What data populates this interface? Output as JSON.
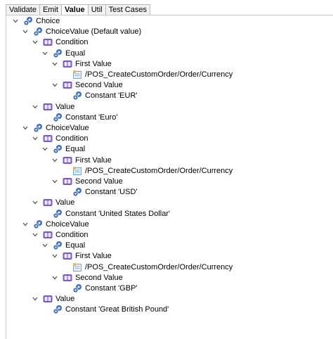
{
  "tabs": [
    {
      "label": "Validate",
      "active": false
    },
    {
      "label": "Emit",
      "active": false
    },
    {
      "label": "Value",
      "active": true
    },
    {
      "label": "Util",
      "active": false
    },
    {
      "label": "Test Cases",
      "active": false
    }
  ],
  "tree": [
    {
      "label": "Choice",
      "depth": 0,
      "icon": "gears-icon",
      "expanded": true
    },
    {
      "label": "ChoiceValue (Default value)",
      "depth": 1,
      "icon": "gears-icon",
      "expanded": true
    },
    {
      "label": "Condition",
      "depth": 2,
      "icon": "condition-icon",
      "expanded": true
    },
    {
      "label": "Equal",
      "depth": 3,
      "icon": "gears-icon",
      "expanded": true
    },
    {
      "label": "First Value",
      "depth": 4,
      "icon": "condition-icon",
      "expanded": true
    },
    {
      "label": "/POS_CreateCustomOrder/Order/Currency",
      "depth": 5,
      "icon": "path-node-icon",
      "expanded": null
    },
    {
      "label": "Second Value",
      "depth": 4,
      "icon": "condition-icon",
      "expanded": true
    },
    {
      "label": "Constant 'EUR'",
      "depth": 5,
      "icon": "gears-icon",
      "expanded": null
    },
    {
      "label": "Value",
      "depth": 2,
      "icon": "condition-icon",
      "expanded": true
    },
    {
      "label": "Constant 'Euro'",
      "depth": 3,
      "icon": "gears-icon",
      "expanded": null
    },
    {
      "label": "ChoiceValue",
      "depth": 1,
      "icon": "gears-icon",
      "expanded": true
    },
    {
      "label": "Condition",
      "depth": 2,
      "icon": "condition-icon",
      "expanded": true
    },
    {
      "label": "Equal",
      "depth": 3,
      "icon": "gears-icon",
      "expanded": true
    },
    {
      "label": "First Value",
      "depth": 4,
      "icon": "condition-icon",
      "expanded": true
    },
    {
      "label": "/POS_CreateCustomOrder/Order/Currency",
      "depth": 5,
      "icon": "path-node-icon",
      "expanded": null
    },
    {
      "label": "Second Value",
      "depth": 4,
      "icon": "condition-icon",
      "expanded": true
    },
    {
      "label": "Constant 'USD'",
      "depth": 5,
      "icon": "gears-icon",
      "expanded": null
    },
    {
      "label": "Value",
      "depth": 2,
      "icon": "condition-icon",
      "expanded": true
    },
    {
      "label": "Constant 'United States Dollar'",
      "depth": 3,
      "icon": "gears-icon",
      "expanded": null
    },
    {
      "label": "ChoiceValue",
      "depth": 1,
      "icon": "gears-icon",
      "expanded": true
    },
    {
      "label": "Condition",
      "depth": 2,
      "icon": "condition-icon",
      "expanded": true
    },
    {
      "label": "Equal",
      "depth": 3,
      "icon": "gears-icon",
      "expanded": true
    },
    {
      "label": "First Value",
      "depth": 4,
      "icon": "condition-icon",
      "expanded": true
    },
    {
      "label": "/POS_CreateCustomOrder/Order/Currency",
      "depth": 5,
      "icon": "path-node-icon",
      "expanded": null
    },
    {
      "label": "Second Value",
      "depth": 4,
      "icon": "condition-icon",
      "expanded": true
    },
    {
      "label": "Constant 'GBP'",
      "depth": 5,
      "icon": "gears-icon",
      "expanded": null
    },
    {
      "label": "Value",
      "depth": 2,
      "icon": "condition-icon",
      "expanded": true
    },
    {
      "label": "Constant 'Great British Pound'",
      "depth": 3,
      "icon": "gears-icon",
      "expanded": null
    }
  ],
  "colors": {
    "gear_blue": "#3c6fc4",
    "condition_purple": "#7a5ac8",
    "path_node_blue": "#6fa4dc",
    "path_node_yellow": "#e8b64a"
  }
}
